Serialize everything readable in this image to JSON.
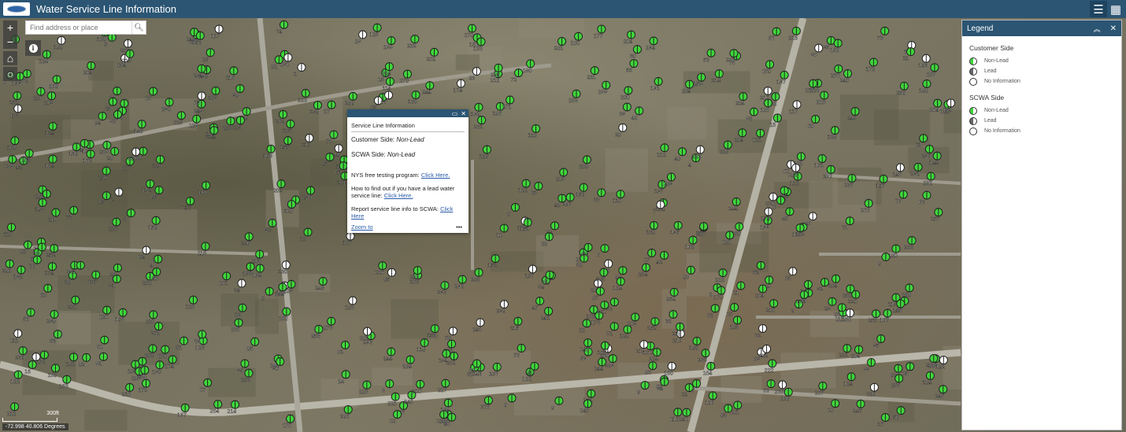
{
  "header": {
    "title": "Water Service Line Information",
    "legend_button_icon": "list-icon",
    "basemap_button_icon": "grid-icon"
  },
  "search": {
    "placeholder": "Find address or place"
  },
  "controls": {
    "zoom_in": "+",
    "zoom_out": "−",
    "info": "i"
  },
  "popup": {
    "title": "Service Line Information",
    "customer_label": "Customer Side:",
    "customer_value": "Non-Lead",
    "scwa_label": "SCWA Side:",
    "scwa_value": "Non-Lead",
    "nys_text": "NYS free testing program:",
    "nys_link": "Click Here.",
    "find_text": "How to find out if you have a lead water service line:",
    "find_link": "Click Here.",
    "report_text": "Report service line info to SCWA:",
    "report_link": "Click Here",
    "zoom_to": "Zoom to",
    "more": "•••"
  },
  "legend": {
    "title": "Legend",
    "sections": [
      {
        "title": "Customer Side",
        "items": [
          {
            "label": "Non-Lead",
            "color": "#3fd63a"
          },
          {
            "label": "Lead",
            "color": "#666666"
          },
          {
            "label": "No Information",
            "color": "#ffffff"
          }
        ]
      },
      {
        "title": "SCWA Side",
        "items": [
          {
            "label": "Non-Lead",
            "color": "#3fd63a"
          },
          {
            "label": "Lead",
            "color": "#666666"
          },
          {
            "label": "No Information",
            "color": "#ffffff"
          }
        ]
      }
    ]
  },
  "map": {
    "scale_label": "300ft",
    "coordinates": "-72.998 40.806 Degrees",
    "marker_colors": {
      "non_lead": "#3fd63a",
      "no_info": "#ffffff"
    }
  }
}
